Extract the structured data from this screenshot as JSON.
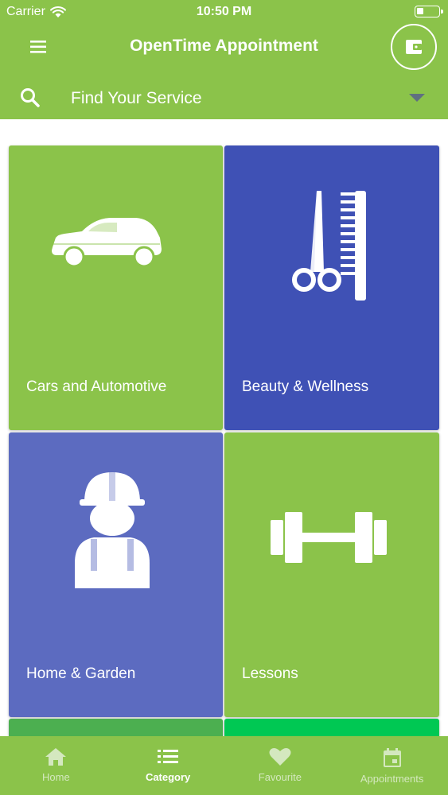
{
  "status_bar": {
    "carrier": "Carrier",
    "time": "10:50 PM",
    "battery_level": 0.3
  },
  "header": {
    "title": "OpenTime Appointment",
    "menu_icon": "hamburger-icon",
    "wallet_icon": "wallet-icon"
  },
  "search": {
    "placeholder": "Find Your Service",
    "search_icon": "search-icon",
    "dropdown_icon": "dropdown-arrow-icon"
  },
  "categories": [
    {
      "label": "Cars and Automotive",
      "icon": "car-icon",
      "color": "#8bc34a"
    },
    {
      "label": "Beauty & Wellness",
      "icon": "scissors-comb-icon",
      "color": "#3f51b5"
    },
    {
      "label": "Home & Garden",
      "icon": "worker-icon",
      "color": "#5c6bc0"
    },
    {
      "label": "Lessons",
      "icon": "dumbbell-icon",
      "color": "#8bc34a"
    },
    {
      "label": "",
      "color": "#4caf50"
    },
    {
      "label": "",
      "color": "#00c853"
    }
  ],
  "tabbar": {
    "tabs": [
      {
        "label": "Home",
        "icon": "home-icon",
        "active": false
      },
      {
        "label": "Category",
        "icon": "list-icon",
        "active": true
      },
      {
        "label": "Favourite",
        "icon": "heart-icon",
        "active": false
      },
      {
        "label": "Appointments",
        "icon": "calendar-icon",
        "active": false
      }
    ]
  },
  "colors": {
    "primary": "#8bc34a",
    "indigo": "#3f51b5",
    "indigo_light": "#5c6bc0"
  }
}
